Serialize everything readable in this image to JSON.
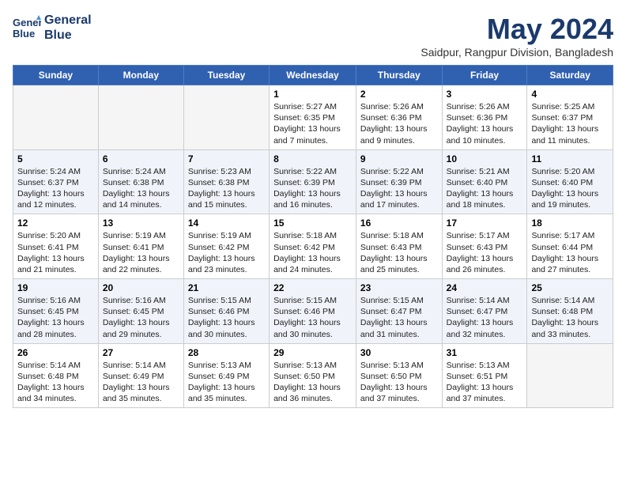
{
  "logo": {
    "line1": "General",
    "line2": "Blue"
  },
  "title": "May 2024",
  "location": "Saidpur, Rangpur Division, Bangladesh",
  "days_of_week": [
    "Sunday",
    "Monday",
    "Tuesday",
    "Wednesday",
    "Thursday",
    "Friday",
    "Saturday"
  ],
  "weeks": [
    [
      {
        "num": "",
        "info": ""
      },
      {
        "num": "",
        "info": ""
      },
      {
        "num": "",
        "info": ""
      },
      {
        "num": "1",
        "info": "Sunrise: 5:27 AM\nSunset: 6:35 PM\nDaylight: 13 hours\nand 7 minutes."
      },
      {
        "num": "2",
        "info": "Sunrise: 5:26 AM\nSunset: 6:36 PM\nDaylight: 13 hours\nand 9 minutes."
      },
      {
        "num": "3",
        "info": "Sunrise: 5:26 AM\nSunset: 6:36 PM\nDaylight: 13 hours\nand 10 minutes."
      },
      {
        "num": "4",
        "info": "Sunrise: 5:25 AM\nSunset: 6:37 PM\nDaylight: 13 hours\nand 11 minutes."
      }
    ],
    [
      {
        "num": "5",
        "info": "Sunrise: 5:24 AM\nSunset: 6:37 PM\nDaylight: 13 hours\nand 12 minutes."
      },
      {
        "num": "6",
        "info": "Sunrise: 5:24 AM\nSunset: 6:38 PM\nDaylight: 13 hours\nand 14 minutes."
      },
      {
        "num": "7",
        "info": "Sunrise: 5:23 AM\nSunset: 6:38 PM\nDaylight: 13 hours\nand 15 minutes."
      },
      {
        "num": "8",
        "info": "Sunrise: 5:22 AM\nSunset: 6:39 PM\nDaylight: 13 hours\nand 16 minutes."
      },
      {
        "num": "9",
        "info": "Sunrise: 5:22 AM\nSunset: 6:39 PM\nDaylight: 13 hours\nand 17 minutes."
      },
      {
        "num": "10",
        "info": "Sunrise: 5:21 AM\nSunset: 6:40 PM\nDaylight: 13 hours\nand 18 minutes."
      },
      {
        "num": "11",
        "info": "Sunrise: 5:20 AM\nSunset: 6:40 PM\nDaylight: 13 hours\nand 19 minutes."
      }
    ],
    [
      {
        "num": "12",
        "info": "Sunrise: 5:20 AM\nSunset: 6:41 PM\nDaylight: 13 hours\nand 21 minutes."
      },
      {
        "num": "13",
        "info": "Sunrise: 5:19 AM\nSunset: 6:41 PM\nDaylight: 13 hours\nand 22 minutes."
      },
      {
        "num": "14",
        "info": "Sunrise: 5:19 AM\nSunset: 6:42 PM\nDaylight: 13 hours\nand 23 minutes."
      },
      {
        "num": "15",
        "info": "Sunrise: 5:18 AM\nSunset: 6:42 PM\nDaylight: 13 hours\nand 24 minutes."
      },
      {
        "num": "16",
        "info": "Sunrise: 5:18 AM\nSunset: 6:43 PM\nDaylight: 13 hours\nand 25 minutes."
      },
      {
        "num": "17",
        "info": "Sunrise: 5:17 AM\nSunset: 6:43 PM\nDaylight: 13 hours\nand 26 minutes."
      },
      {
        "num": "18",
        "info": "Sunrise: 5:17 AM\nSunset: 6:44 PM\nDaylight: 13 hours\nand 27 minutes."
      }
    ],
    [
      {
        "num": "19",
        "info": "Sunrise: 5:16 AM\nSunset: 6:45 PM\nDaylight: 13 hours\nand 28 minutes."
      },
      {
        "num": "20",
        "info": "Sunrise: 5:16 AM\nSunset: 6:45 PM\nDaylight: 13 hours\nand 29 minutes."
      },
      {
        "num": "21",
        "info": "Sunrise: 5:15 AM\nSunset: 6:46 PM\nDaylight: 13 hours\nand 30 minutes."
      },
      {
        "num": "22",
        "info": "Sunrise: 5:15 AM\nSunset: 6:46 PM\nDaylight: 13 hours\nand 30 minutes."
      },
      {
        "num": "23",
        "info": "Sunrise: 5:15 AM\nSunset: 6:47 PM\nDaylight: 13 hours\nand 31 minutes."
      },
      {
        "num": "24",
        "info": "Sunrise: 5:14 AM\nSunset: 6:47 PM\nDaylight: 13 hours\nand 32 minutes."
      },
      {
        "num": "25",
        "info": "Sunrise: 5:14 AM\nSunset: 6:48 PM\nDaylight: 13 hours\nand 33 minutes."
      }
    ],
    [
      {
        "num": "26",
        "info": "Sunrise: 5:14 AM\nSunset: 6:48 PM\nDaylight: 13 hours\nand 34 minutes."
      },
      {
        "num": "27",
        "info": "Sunrise: 5:14 AM\nSunset: 6:49 PM\nDaylight: 13 hours\nand 35 minutes."
      },
      {
        "num": "28",
        "info": "Sunrise: 5:13 AM\nSunset: 6:49 PM\nDaylight: 13 hours\nand 35 minutes."
      },
      {
        "num": "29",
        "info": "Sunrise: 5:13 AM\nSunset: 6:50 PM\nDaylight: 13 hours\nand 36 minutes."
      },
      {
        "num": "30",
        "info": "Sunrise: 5:13 AM\nSunset: 6:50 PM\nDaylight: 13 hours\nand 37 minutes."
      },
      {
        "num": "31",
        "info": "Sunrise: 5:13 AM\nSunset: 6:51 PM\nDaylight: 13 hours\nand 37 minutes."
      },
      {
        "num": "",
        "info": ""
      }
    ]
  ]
}
